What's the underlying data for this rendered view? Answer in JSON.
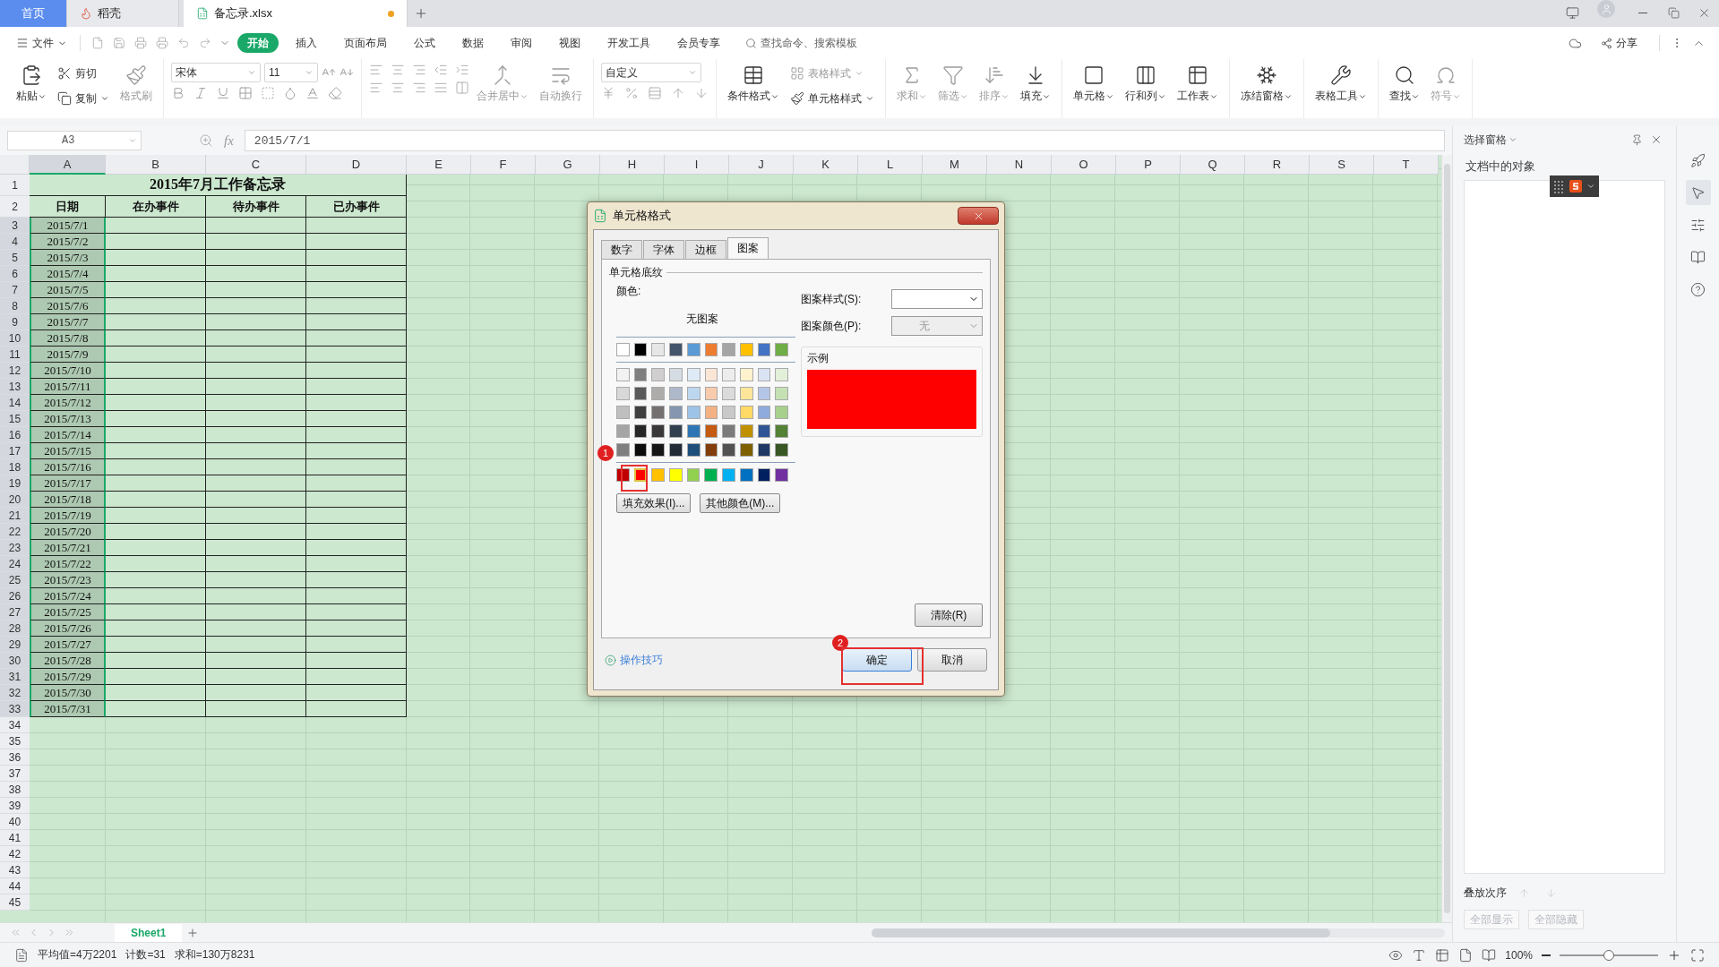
{
  "tabs": [
    {
      "label": "首页",
      "kind": "home",
      "selected": false
    },
    {
      "label": "稻壳",
      "kind": "docer",
      "selected": false
    },
    {
      "label": "备忘录.xlsx",
      "kind": "sheet",
      "selected": true,
      "modified": true
    }
  ],
  "menu": {
    "file": "文件",
    "items": [
      {
        "label": "开始",
        "selected": true
      },
      {
        "label": "插入",
        "selected": false
      },
      {
        "label": "页面布局",
        "selected": false
      },
      {
        "label": "公式",
        "selected": false
      },
      {
        "label": "数据",
        "selected": false
      },
      {
        "label": "审阅",
        "selected": false
      },
      {
        "label": "视图",
        "selected": false
      },
      {
        "label": "开发工具",
        "selected": false
      },
      {
        "label": "会员专享",
        "selected": false
      }
    ],
    "search_placeholder": "查找命令、搜索模板",
    "share": "分享"
  },
  "ribbon": {
    "clipboard": [
      {
        "label": "粘贴",
        "caret": true,
        "disabled": false
      },
      {
        "label": "剪切",
        "caret": false,
        "disabled": false
      },
      {
        "label": "复制",
        "caret": true,
        "disabled": false
      },
      {
        "label": "格式刷",
        "caret": false,
        "disabled": true
      }
    ],
    "font": {
      "name": "宋体",
      "size": "11"
    },
    "alignment": [
      {
        "label": "合并居中",
        "caret": true,
        "disabled": true
      },
      {
        "label": "自动换行",
        "caret": false,
        "disabled": true
      }
    ],
    "number_format": "自定义",
    "styles": [
      {
        "label": "条件格式",
        "caret": true,
        "disabled": false
      },
      {
        "label": "表格样式",
        "caret": true,
        "disabled": true
      },
      {
        "label": "单元格样式",
        "caret": true,
        "disabled": false
      }
    ],
    "tools": [
      {
        "label": "求和",
        "caret": true,
        "disabled": true
      },
      {
        "label": "筛选",
        "caret": true,
        "disabled": true
      },
      {
        "label": "排序",
        "caret": true,
        "disabled": true
      },
      {
        "label": "填充",
        "caret": true,
        "disabled": false
      },
      {
        "label": "单元格",
        "caret": true,
        "disabled": false
      },
      {
        "label": "行和列",
        "caret": true,
        "disabled": false
      },
      {
        "label": "工作表",
        "caret": true,
        "disabled": false
      },
      {
        "label": "冻结窗格",
        "caret": true,
        "disabled": false
      },
      {
        "label": "表格工具",
        "caret": true,
        "disabled": false
      },
      {
        "label": "查找",
        "caret": true,
        "disabled": false
      },
      {
        "label": "符号",
        "caret": true,
        "disabled": true
      }
    ]
  },
  "formula_bar": {
    "cell": "A3",
    "fx": "fx",
    "value": "2015/7/1"
  },
  "sheet": {
    "columns": [
      {
        "label": "A",
        "selected": true
      },
      {
        "label": "B",
        "selected": false
      },
      {
        "label": "C",
        "selected": false
      },
      {
        "label": "D",
        "selected": false
      },
      {
        "label": "E",
        "selected": false
      },
      {
        "label": "F",
        "selected": false
      },
      {
        "label": "G",
        "selected": false
      },
      {
        "label": "H",
        "selected": false
      },
      {
        "label": "I",
        "selected": false
      },
      {
        "label": "J",
        "selected": false
      },
      {
        "label": "K",
        "selected": false
      },
      {
        "label": "L",
        "selected": false
      },
      {
        "label": "M",
        "selected": false
      },
      {
        "label": "N",
        "selected": false
      },
      {
        "label": "O",
        "selected": false
      },
      {
        "label": "P",
        "selected": false
      },
      {
        "label": "Q",
        "selected": false
      },
      {
        "label": "R",
        "selected": false
      },
      {
        "label": "S",
        "selected": false
      },
      {
        "label": "T",
        "selected": false
      }
    ],
    "title_row": {
      "number": "1",
      "text": "2015年7月工作备忘录"
    },
    "header_row": {
      "number": "2",
      "headers": [
        "日期",
        "在办事件",
        "待办事件",
        "已办事件"
      ]
    },
    "date_rows": [
      {
        "number": "3",
        "date": "2015/7/1",
        "selected": true
      },
      {
        "number": "4",
        "date": "2015/7/2",
        "selected": true
      },
      {
        "number": "5",
        "date": "2015/7/3",
        "selected": true
      },
      {
        "number": "6",
        "date": "2015/7/4",
        "selected": true
      },
      {
        "number": "7",
        "date": "2015/7/5",
        "selected": true
      },
      {
        "number": "8",
        "date": "2015/7/6",
        "selected": true
      },
      {
        "number": "9",
        "date": "2015/7/7",
        "selected": true
      },
      {
        "number": "10",
        "date": "2015/7/8",
        "selected": true
      },
      {
        "number": "11",
        "date": "2015/7/9",
        "selected": true
      },
      {
        "number": "12",
        "date": "2015/7/10",
        "selected": true
      },
      {
        "number": "13",
        "date": "2015/7/11",
        "selected": true
      },
      {
        "number": "14",
        "date": "2015/7/12",
        "selected": true
      },
      {
        "number": "15",
        "date": "2015/7/13",
        "selected": true
      },
      {
        "number": "16",
        "date": "2015/7/14",
        "selected": true
      },
      {
        "number": "17",
        "date": "2015/7/15",
        "selected": true
      },
      {
        "number": "18",
        "date": "2015/7/16",
        "selected": true
      },
      {
        "number": "19",
        "date": "2015/7/17",
        "selected": true
      },
      {
        "number": "20",
        "date": "2015/7/18",
        "selected": true
      },
      {
        "number": "21",
        "date": "2015/7/19",
        "selected": true
      },
      {
        "number": "22",
        "date": "2015/7/20",
        "selected": true
      },
      {
        "number": "23",
        "date": "2015/7/21",
        "selected": true
      },
      {
        "number": "24",
        "date": "2015/7/22",
        "selected": true
      },
      {
        "number": "25",
        "date": "2015/7/23",
        "selected": true
      },
      {
        "number": "26",
        "date": "2015/7/24",
        "selected": true
      },
      {
        "number": "27",
        "date": "2015/7/25",
        "selected": true
      },
      {
        "number": "28",
        "date": "2015/7/26",
        "selected": true
      },
      {
        "number": "29",
        "date": "2015/7/27",
        "selected": true
      },
      {
        "number": "30",
        "date": "2015/7/28",
        "selected": true
      },
      {
        "number": "31",
        "date": "2015/7/29",
        "selected": true
      },
      {
        "number": "32",
        "date": "2015/7/30",
        "selected": true
      },
      {
        "number": "33",
        "date": "2015/7/31",
        "selected": true
      }
    ],
    "empty_rows": [
      "34",
      "35",
      "36",
      "37",
      "38",
      "39",
      "40",
      "41",
      "42",
      "43",
      "44",
      "45"
    ],
    "sheet_tabs": [
      {
        "label": "Sheet1",
        "selected": true
      }
    ]
  },
  "status_bar": {
    "stats": [
      "平均值=4万2201",
      "计数=31",
      "求和=130万8231"
    ],
    "zoom": "100%",
    "zoom_slider": {
      "level": 0.5
    }
  },
  "selection_pane": {
    "title": "选择窗格",
    "objects_label": "文档中的对象",
    "order_label": "叠放次序",
    "buttons": [
      "全部显示",
      "全部隐藏"
    ]
  },
  "dialog": {
    "title": "单元格格式",
    "tabs": [
      {
        "label": "数字",
        "selected": false
      },
      {
        "label": "字体",
        "selected": false
      },
      {
        "label": "边框",
        "selected": false
      },
      {
        "label": "图案",
        "selected": true
      }
    ],
    "section": "单元格底纹",
    "color_label": "颜色:",
    "no_pattern": "无图案",
    "theme_row": [
      {
        "color": "#ffffff",
        "selected": false
      },
      {
        "color": "#000000",
        "selected": false
      },
      {
        "color": "#e7e6e6",
        "selected": false
      },
      {
        "color": "#44546a",
        "selected": false
      },
      {
        "color": "#5b9bd5",
        "selected": false
      },
      {
        "color": "#ed7d31",
        "selected": false
      },
      {
        "color": "#a5a5a5",
        "selected": false
      },
      {
        "color": "#ffc000",
        "selected": false
      },
      {
        "color": "#4472c4",
        "selected": false
      },
      {
        "color": "#70ad47",
        "selected": false
      }
    ],
    "tint_rows": [
      [
        {
          "color": "#f2f2f2",
          "selected": false
        },
        {
          "color": "#7f7f7f",
          "selected": false
        },
        {
          "color": "#d0cece",
          "selected": false
        },
        {
          "color": "#d6dce4",
          "selected": false
        },
        {
          "color": "#deebf6",
          "selected": false
        },
        {
          "color": "#fbe5d5",
          "selected": false
        },
        {
          "color": "#ededed",
          "selected": false
        },
        {
          "color": "#fff2cc",
          "selected": false
        },
        {
          "color": "#dae3f3",
          "selected": false
        },
        {
          "color": "#e2efd9",
          "selected": false
        }
      ],
      [
        {
          "color": "#d8d8d8",
          "selected": false
        },
        {
          "color": "#595959",
          "selected": false
        },
        {
          "color": "#aeabab",
          "selected": false
        },
        {
          "color": "#adb9ca",
          "selected": false
        },
        {
          "color": "#bdd7ee",
          "selected": false
        },
        {
          "color": "#f7cbac",
          "selected": false
        },
        {
          "color": "#dbdbdb",
          "selected": false
        },
        {
          "color": "#fee599",
          "selected": false
        },
        {
          "color": "#b4c6e7",
          "selected": false
        },
        {
          "color": "#c5e0b3",
          "selected": false
        }
      ],
      [
        {
          "color": "#bfbfbf",
          "selected": false
        },
        {
          "color": "#3f3f3f",
          "selected": false
        },
        {
          "color": "#757070",
          "selected": false
        },
        {
          "color": "#8496b0",
          "selected": false
        },
        {
          "color": "#9dc3e6",
          "selected": false
        },
        {
          "color": "#f4b183",
          "selected": false
        },
        {
          "color": "#c9c9c9",
          "selected": false
        },
        {
          "color": "#ffd965",
          "selected": false
        },
        {
          "color": "#8faadc",
          "selected": false
        },
        {
          "color": "#a8d08d",
          "selected": false
        }
      ],
      [
        {
          "color": "#a5a5a5",
          "selected": false
        },
        {
          "color": "#262626",
          "selected": false
        },
        {
          "color": "#3a3838",
          "selected": false
        },
        {
          "color": "#323f4f",
          "selected": false
        },
        {
          "color": "#2e75b5",
          "selected": false
        },
        {
          "color": "#c55a11",
          "selected": false
        },
        {
          "color": "#7b7b7b",
          "selected": false
        },
        {
          "color": "#bf9000",
          "selected": false
        },
        {
          "color": "#2f5496",
          "selected": false
        },
        {
          "color": "#538135",
          "selected": false
        }
      ],
      [
        {
          "color": "#7f7f7f",
          "selected": false
        },
        {
          "color": "#0c0c0c",
          "selected": false
        },
        {
          "color": "#171616",
          "selected": false
        },
        {
          "color": "#222a35",
          "selected": false
        },
        {
          "color": "#1e4e79",
          "selected": false
        },
        {
          "color": "#833c0b",
          "selected": false
        },
        {
          "color": "#525252",
          "selected": false
        },
        {
          "color": "#7f6000",
          "selected": false
        },
        {
          "color": "#1f3864",
          "selected": false
        },
        {
          "color": "#375623",
          "selected": false
        }
      ]
    ],
    "standard_row": [
      {
        "color": "#c00000",
        "selected": false
      },
      {
        "color": "#ff0000",
        "selected": true
      },
      {
        "color": "#ffc000",
        "selected": false
      },
      {
        "color": "#ffff00",
        "selected": false
      },
      {
        "color": "#92d050",
        "selected": false
      },
      {
        "color": "#00b050",
        "selected": false
      },
      {
        "color": "#00b0f0",
        "selected": false
      },
      {
        "color": "#0070c0",
        "selected": false
      },
      {
        "color": "#002060",
        "selected": false
      },
      {
        "color": "#7030a0",
        "selected": false
      }
    ],
    "fill_effects": "填充效果(I)...",
    "more_colors": "其他颜色(M)...",
    "pattern_style_label": "图案样式(S):",
    "pattern_color_label": "图案颜色(P):",
    "pattern_color": {
      "value": "无",
      "disabled": true
    },
    "sample_label": "示例",
    "clear": "清除(R)",
    "tips": "操作技巧",
    "ok": "确定",
    "cancel": "取消",
    "callouts": [
      "1",
      "2"
    ]
  }
}
